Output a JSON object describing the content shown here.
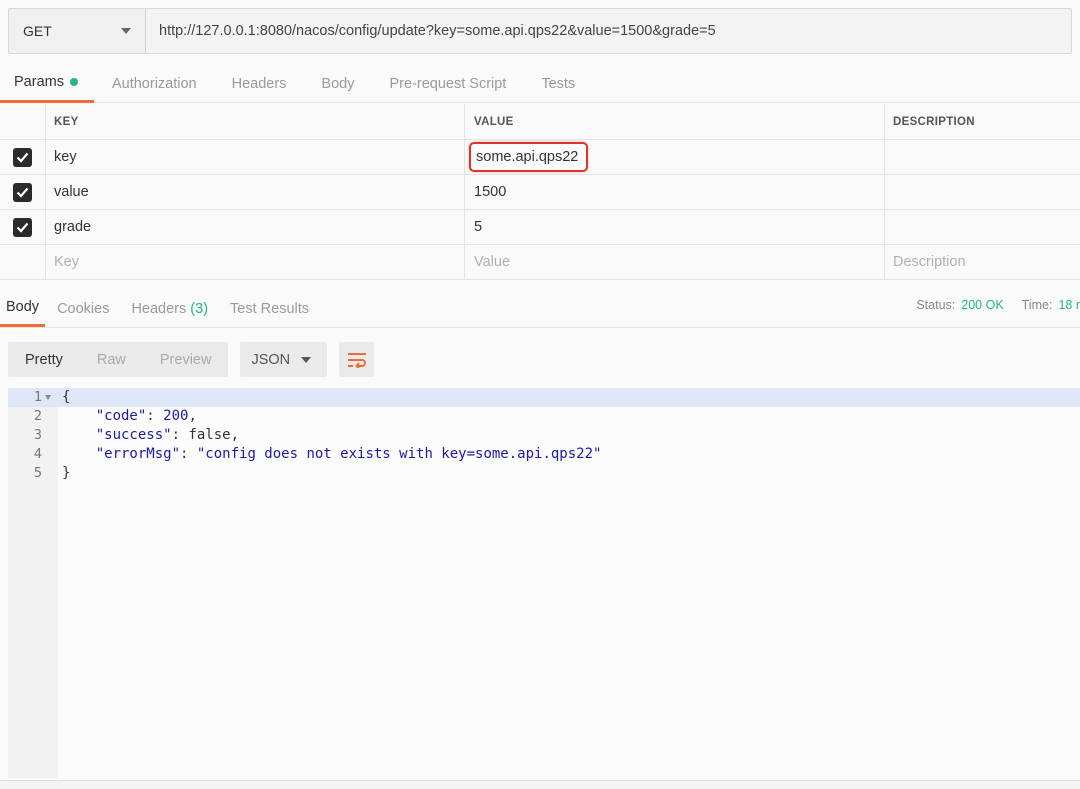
{
  "request": {
    "method": "GET",
    "url": "http://127.0.0.1:8080/nacos/config/update?key=some.api.qps22&value=1500&grade=5"
  },
  "request_tabs": [
    "Params",
    "Authorization",
    "Headers",
    "Body",
    "Pre-request Script",
    "Tests"
  ],
  "params": {
    "headers": [
      "KEY",
      "VALUE",
      "DESCRIPTION"
    ],
    "rows": [
      {
        "key": "key",
        "value": "some.api.qps22",
        "description": "",
        "checked": true
      },
      {
        "key": "value",
        "value": "1500",
        "description": "",
        "checked": true
      },
      {
        "key": "grade",
        "value": "5",
        "description": "",
        "checked": true
      }
    ],
    "placeholders": {
      "key": "Key",
      "value": "Value",
      "description": "Description"
    }
  },
  "response_tabs": {
    "body": "Body",
    "cookies": "Cookies",
    "headers": "Headers",
    "headers_count": "(3)",
    "test_results": "Test Results"
  },
  "status": {
    "status_label": "Status:",
    "status_value": "200 OK",
    "time_label": "Time:",
    "time_value": "18 r"
  },
  "toolbar": {
    "pretty": "Pretty",
    "raw": "Raw",
    "preview": "Preview",
    "format": "JSON"
  },
  "response_body": {
    "line_numbers": [
      "1",
      "2",
      "3",
      "4",
      "5"
    ],
    "open_brace": "{",
    "close_brace": "}",
    "code_key": "\"code\"",
    "code_value": "200",
    "success_key": "\"success\"",
    "success_value": "false",
    "error_key": "\"errorMsg\"",
    "error_value": "\"config does not exists with key=some.api.qps22\""
  },
  "colors": {
    "accent": "#f26b3a",
    "success": "#26b47f",
    "highlight_box": "#d8382c"
  }
}
